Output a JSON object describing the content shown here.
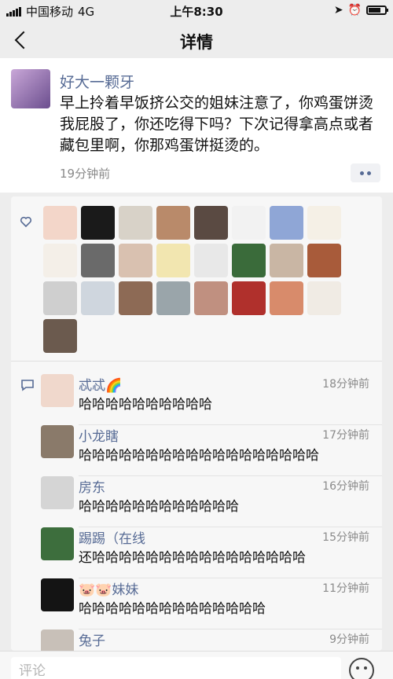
{
  "status_bar": {
    "carrier": "中国移动",
    "network": "4G",
    "time": "上午8:30"
  },
  "nav": {
    "title": "详情"
  },
  "post": {
    "author": "好大一颗牙",
    "text": "早上拎着早饭挤公交的姐妹注意了，你鸡蛋饼烫我屁股了，你还吃得下吗？下次记得拿高点或者藏包里啊，你那鸡蛋饼挺烫的。",
    "time": "19分钟前"
  },
  "likes": {
    "colors": [
      "#f3d6c9",
      "#1a1a1a",
      "#d8d2c8",
      "#b98a6a",
      "#5a4a42",
      "#f2f2f2",
      "#8fa6d6",
      "#f5f0e6",
      "#f4efe8",
      "#6a6a6a",
      "#d9c1b0",
      "#f2e6b0",
      "#e8e8e8",
      "#3a6b3a",
      "#c9b6a4",
      "#a85b3a",
      "#cfcfcf",
      "#cfd6de",
      "#8d6a55",
      "#9aa5aa",
      "#c09080",
      "#b0302c",
      "#d88b6b",
      "#f0ebe4",
      "#6b5a4e"
    ],
    "note": ""
  },
  "comments": [
    {
      "name": "忒忒🌈",
      "time": "18分钟前",
      "text": "哈哈哈哈哈哈哈哈哈哈",
      "color": "#f0d8cc"
    },
    {
      "name": "小龙瞎",
      "time": "17分钟前",
      "text": "哈哈哈哈哈哈哈哈哈哈哈哈哈哈哈哈哈哈",
      "color": "#8a7a6a"
    },
    {
      "name": "房东",
      "time": "16分钟前",
      "text": "哈哈哈哈哈哈哈哈哈哈哈哈",
      "color": "#d5d5d5"
    },
    {
      "name": "踢踢（在线",
      "time": "15分钟前",
      "text": "还哈哈哈哈哈哈哈哈哈哈哈哈哈哈哈哈",
      "color": "#3d6e3d"
    },
    {
      "name": "🐷🐷妹妹",
      "time": "11分钟前",
      "text": "哈哈哈哈哈哈哈哈哈哈哈哈哈哈",
      "color": "#141414"
    },
    {
      "name": "兔子",
      "time": "9分钟前",
      "text": "",
      "color": "#c8c0b8"
    }
  ],
  "input": {
    "placeholder": "评论"
  }
}
